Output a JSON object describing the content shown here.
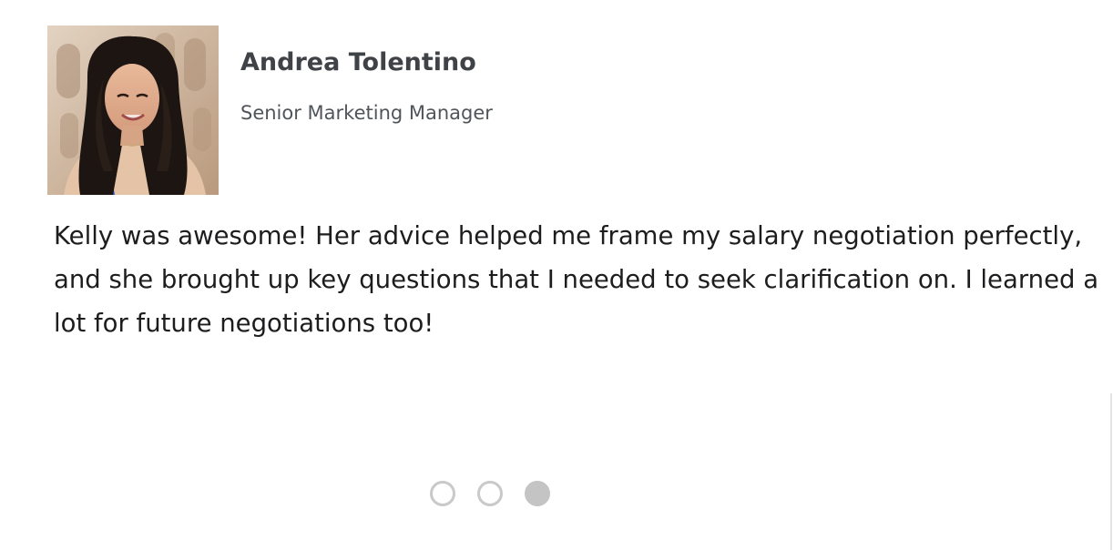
{
  "testimonial": {
    "name": "Andrea Tolentino",
    "role": "Senior Marketing Manager",
    "quote": "Kelly was awesome! Her advice helped me frame my salary negotiation perfectly, and she brought up key questions that I needed to seek clarification on. I learned a lot for future negotiations too!",
    "photo_alt": "Andrea Tolentino"
  },
  "carousel": {
    "slide_count": 3,
    "active_index": 2,
    "dot_color": "#c4c4c4"
  }
}
